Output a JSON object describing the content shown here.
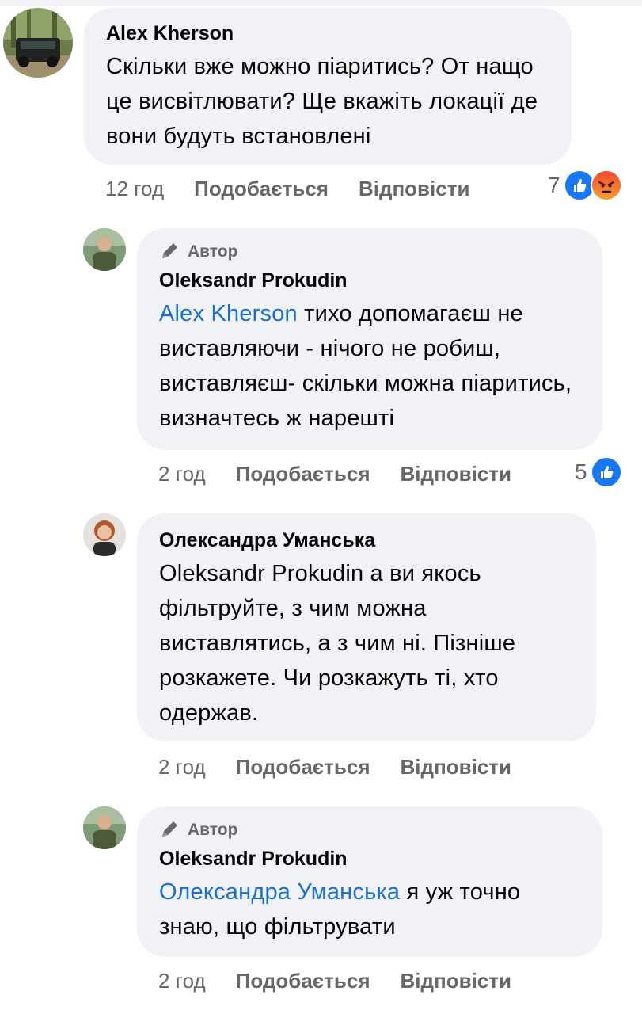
{
  "comments": [
    {
      "author": "Alex Kherson",
      "is_author_badge": false,
      "text": "Скільки вже можно піаритись? От нащо це висвітлювати? Ще вкажіть локації де вони будуть встановлені",
      "time": "12 год",
      "like_label": "Подобається",
      "reply_label": "Відповісти",
      "reaction_count": "7",
      "reactions": [
        "like-icon",
        "angry-icon"
      ]
    },
    {
      "author_badge": "Автор",
      "author": "Oleksandr Prokudin",
      "mention": "Alex Kherson",
      "text": " тихо допомагаєш не виставляючи - нічого не робиш, виставляєш- скільки можна піаритись, визначтесь ж нарешті",
      "time": "2 год",
      "like_label": "Подобається",
      "reply_label": "Відповісти",
      "reaction_count": "5",
      "reactions": [
        "like-icon"
      ]
    },
    {
      "author": "Олександра Уманська",
      "text": "Oleksandr Prokudin а ви якось фільтруйте, з чим можна виставлятись, а з чим ні. Пізніше розкажете. Чи розкажуть ті, хто одержав.",
      "time": "2 год",
      "like_label": "Подобається",
      "reply_label": "Відповісти"
    },
    {
      "author_badge": "Автор",
      "author": "Oleksandr Prokudin",
      "mention": "Олександра Уманська",
      "text": " я уж точно знаю, що фільтрувати",
      "time": "2 год",
      "like_label": "Подобається",
      "reply_label": "Відповісти"
    }
  ],
  "colors": {
    "bubble": "#f0f2f5",
    "mention": "#1a6fd6",
    "meta": "#65676b",
    "like_blue": "#1877f2"
  }
}
